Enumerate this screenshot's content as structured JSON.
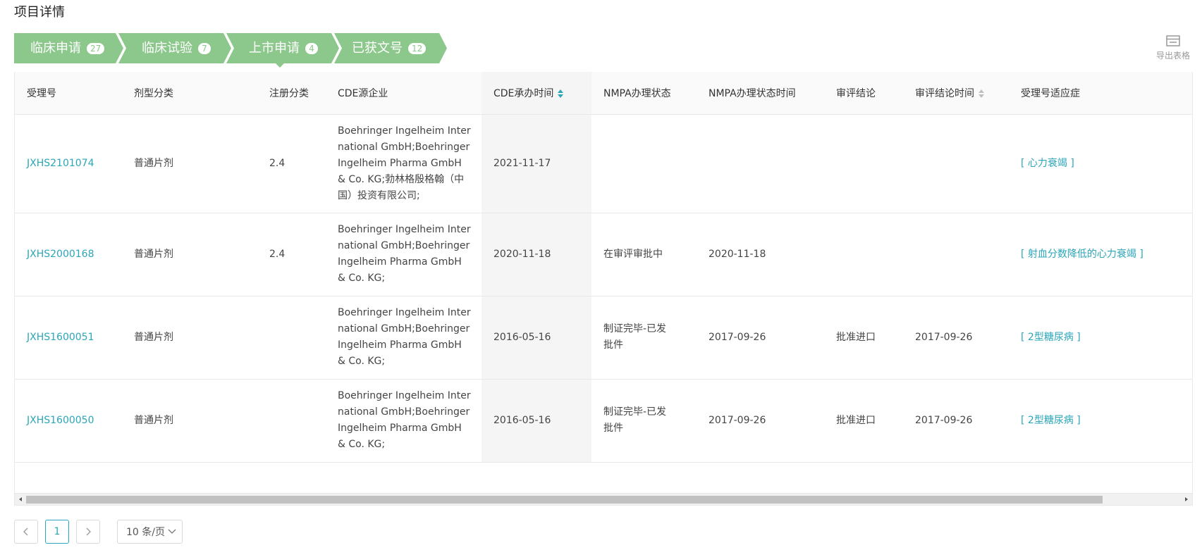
{
  "page": {
    "title": "项目详情"
  },
  "tabs": [
    {
      "label": "临床申请",
      "count": "27"
    },
    {
      "label": "临床试验",
      "count": "7"
    },
    {
      "label": "上市申请",
      "count": "4"
    },
    {
      "label": "已获文号",
      "count": "12"
    }
  ],
  "active_tab_index": 2,
  "toolbar": {
    "export_label": "导出表格",
    "export_icon": "table-export-icon"
  },
  "colors": {
    "tab_green": "#8cc88c",
    "link": "#2ba6b8",
    "header_bg": "#fafafa"
  },
  "table": {
    "columns": [
      "受理号",
      "剂型分类",
      "注册分类",
      "CDE源企业",
      "CDE承办时间",
      "NMPA办理状态",
      "NMPA办理状态时间",
      "审评结论",
      "审评结论时间",
      "受理号适应症"
    ],
    "rows": [
      {
        "id": "JXHS2101074",
        "form": "普通片剂",
        "reg_class": "2.4",
        "company": "Boehringer Ingelheim International GmbH;Boehringer Ingelheim Pharma GmbH & Co. KG;勃林格殷格翰（中国）投资有限公司;",
        "cde_date": "2021-11-17",
        "nmpa_status": "",
        "nmpa_date": "",
        "conclusion": "",
        "conclusion_date": "",
        "indication": "[ 心力衰竭 ]"
      },
      {
        "id": "JXHS2000168",
        "form": "普通片剂",
        "reg_class": "2.4",
        "company": "Boehringer Ingelheim International GmbH;Boehringer Ingelheim Pharma GmbH & Co. KG;",
        "cde_date": "2020-11-18",
        "nmpa_status": "在审评审批中",
        "nmpa_date": "2020-11-18",
        "conclusion": "",
        "conclusion_date": "",
        "indication": "[ 射血分数降低的心力衰竭 ]"
      },
      {
        "id": "JXHS1600051",
        "form": "普通片剂",
        "reg_class": "",
        "company": "Boehringer Ingelheim International GmbH;Boehringer Ingelheim Pharma GmbH & Co. KG;",
        "cde_date": "2016-05-16",
        "nmpa_status": "制证完毕-已发批件",
        "nmpa_date": "2017-09-26",
        "conclusion": "批准进口",
        "conclusion_date": "2017-09-26",
        "indication": "[ 2型糖尿病 ]"
      },
      {
        "id": "JXHS1600050",
        "form": "普通片剂",
        "reg_class": "",
        "company": "Boehringer Ingelheim International GmbH;Boehringer Ingelheim Pharma GmbH & Co. KG;",
        "cde_date": "2016-05-16",
        "nmpa_status": "制证完毕-已发批件",
        "nmpa_date": "2017-09-26",
        "conclusion": "批准进口",
        "conclusion_date": "2017-09-26",
        "indication": "[ 2型糖尿病 ]"
      }
    ]
  },
  "pagination": {
    "current_page": "1",
    "page_size": "10 条/页"
  }
}
